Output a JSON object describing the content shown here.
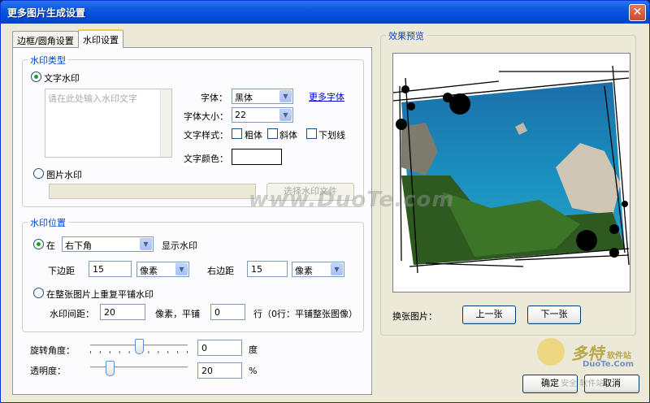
{
  "window": {
    "title": "更多图片生成设置"
  },
  "tabs": [
    {
      "label": "边框/圆角设置"
    },
    {
      "label": "水印设置"
    }
  ],
  "watermark_type": {
    "group_title": "水印类型",
    "text_option_label": "文字水印",
    "text_placeholder": "请在此处输入水印文字",
    "font_label": "字体：",
    "font_value": "黑体",
    "more_fonts_link": "更多字体",
    "font_size_label": "字体大小：",
    "font_size_value": "22",
    "text_style_label": "文字样式：",
    "bold_label": "粗体",
    "italic_label": "斜体",
    "underline_label": "下划线",
    "text_color_label": "文字颜色：",
    "image_option_label": "图片水印",
    "choose_file_button": "选择水印文件"
  },
  "watermark_position": {
    "group_title": "水印位置",
    "at_label": "在",
    "position_value": "右下角",
    "show_label": "显示水印",
    "bottom_margin_label": "下边距",
    "bottom_margin_value": "15",
    "bottom_unit": "像素",
    "right_margin_label": "右边距",
    "right_margin_value": "15",
    "right_unit": "像素",
    "tile_option_label": "在整张图片上重复平铺水印",
    "spacing_label": "水印间距：",
    "spacing_value": "20",
    "spacing_suffix": "像素，平铺",
    "rows_value": "0",
    "rows_suffix": "行（0行：平铺整张图像）"
  },
  "rotation": {
    "label": "旋转角度：",
    "value": "0",
    "unit": "度",
    "level": 0.5
  },
  "opacity": {
    "label": "透明度：",
    "value": "20",
    "unit": "%",
    "level": 0.2
  },
  "preview": {
    "group_title": "效果预览",
    "switch_label": "换张图片：",
    "prev_button": "上一张",
    "next_button": "下一张"
  },
  "footer": {
    "ok_button": "确定",
    "cancel_button": "取消"
  },
  "overlay": {
    "site_watermark": "www.DuoTe.com",
    "logo_main": "多特",
    "logo_sub": "软件站",
    "logo_domain": "DuoTe.Com",
    "logo_slogan": "纯净 安全 软件站"
  }
}
